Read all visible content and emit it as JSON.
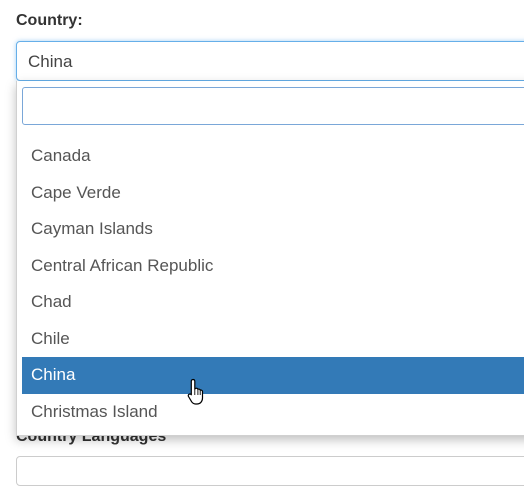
{
  "country_label": "Country:",
  "select_value": "China",
  "search": {
    "value": "",
    "placeholder": ""
  },
  "options": [
    {
      "label": "Canada"
    },
    {
      "label": "Cape Verde"
    },
    {
      "label": "Cayman Islands"
    },
    {
      "label": "Central African Republic"
    },
    {
      "label": "Chad"
    },
    {
      "label": "Chile"
    },
    {
      "label": "China",
      "selected": true
    },
    {
      "label": "Christmas Island"
    }
  ],
  "languages_label": "Country Languages",
  "colors": {
    "highlight": "#337ab7",
    "focus_border": "#66afe9"
  },
  "cursor": "hand-pointer-icon"
}
